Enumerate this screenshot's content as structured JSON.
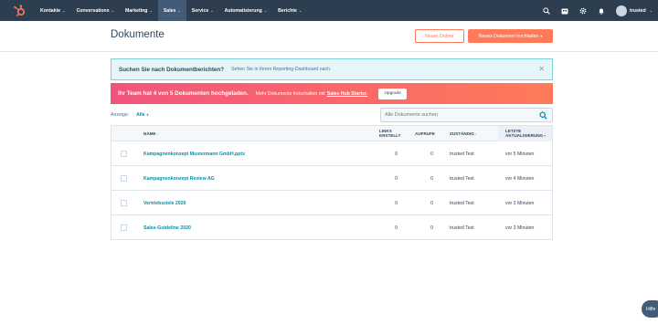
{
  "nav": {
    "items": [
      {
        "label": "Kontakte"
      },
      {
        "label": "Conversations"
      },
      {
        "label": "Marketing"
      },
      {
        "label": "Sales"
      },
      {
        "label": "Service"
      },
      {
        "label": "Automatisierung"
      },
      {
        "label": "Berichte"
      }
    ],
    "active_index": 3,
    "user_label": "trusted",
    "brand_color": "#ff7a59",
    "nav_bg": "#2d3e50"
  },
  "header": {
    "title": "Dokumente",
    "new_folder_label": "Neuer Ordner",
    "upload_label": "Neues Dokument hochladen"
  },
  "info_banner": {
    "title": "Suchen Sie nach Dokumentberichten?",
    "text": "Sehen Sie in Ihrem Reporting-Dashboard nach."
  },
  "promo_banner": {
    "title": "Ihr Team hat 4 von 5 Dokumenten hochgeladen.",
    "text": "Mehr Dokumente freischalten mit",
    "link": "Sales Hub Starter.",
    "button": "Upgrade"
  },
  "filter": {
    "label": "Anzeige:",
    "value": "Alle"
  },
  "search": {
    "placeholder": "Alle Dokumente suchen"
  },
  "table": {
    "columns": {
      "name": "Name",
      "links_line1": "Links",
      "links_line2": "erstellt",
      "views": "Aufrufe",
      "owner": "Zuständig",
      "updated_line1": "Letzte",
      "updated_line2": "Aktualisierung"
    },
    "rows": [
      {
        "name": "Kampagnenkonzept Mustermann GmbH.pptx",
        "links": "0",
        "views": "0",
        "owner": "trusted Test",
        "updated": "vor 5 Minuten"
      },
      {
        "name": "Kampagnenkonzept Review AG",
        "links": "0",
        "views": "0",
        "owner": "trusted Test",
        "updated": "vor 4 Minuten"
      },
      {
        "name": "Vertriebsziele 2020",
        "links": "0",
        "views": "0",
        "owner": "trusted Test",
        "updated": "vor 3 Minuten"
      },
      {
        "name": "Sales-Guideline 2020",
        "links": "0",
        "views": "0",
        "owner": "trusted Test",
        "updated": "vor 3 Minuten"
      }
    ]
  },
  "help": {
    "label": "Hilfe"
  }
}
